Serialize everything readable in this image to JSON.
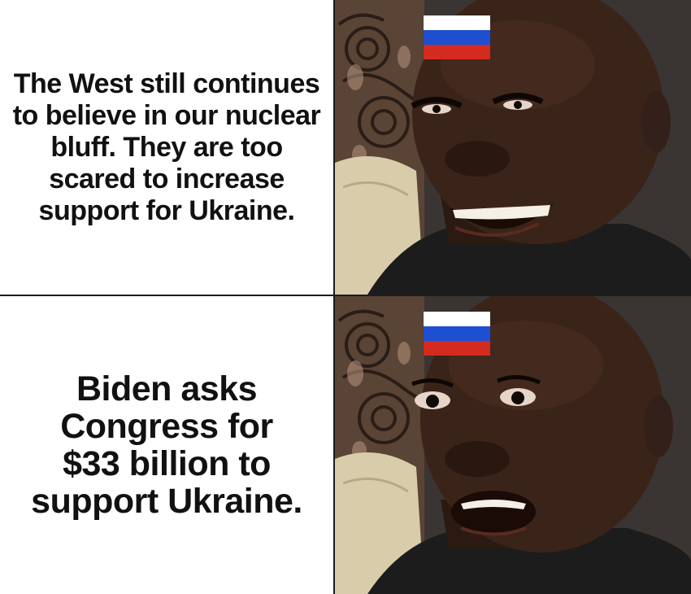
{
  "meme": {
    "top_caption": "The West still continues to believe in our nuclear bluff. They are too scared to increase support for Ukraine.",
    "bottom_caption": "Biden asks Congress for $33 billion to support Ukraine."
  },
  "flag": {
    "icon": "russian-flag-icon",
    "colors": [
      "#ffffff",
      "#1f4fd1",
      "#d52b1e"
    ]
  },
  "colors": {
    "background": "#ffffff",
    "divider": "#1b1b1b",
    "text": "#111111"
  }
}
